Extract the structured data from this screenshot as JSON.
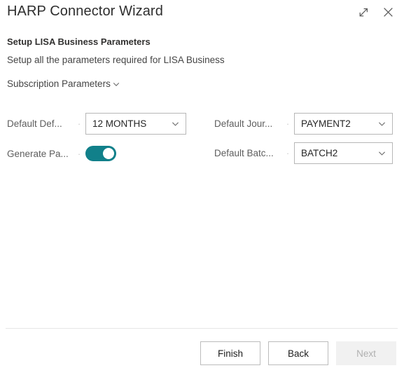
{
  "window": {
    "title": "HARP Connector Wizard",
    "expand_icon": "expand-diagonal-icon",
    "close_icon": "close-icon"
  },
  "step": {
    "heading": "Setup LISA Business Parameters",
    "subheading": "Setup all the parameters required for LISA Business"
  },
  "group": {
    "label": "Subscription Parameters",
    "chevron_icon": "chevron-down-icon",
    "expanded": true
  },
  "form": {
    "separator": "·",
    "left_fields": [
      {
        "label": "Default Def...",
        "type": "combobox",
        "value": "12 MONTHS",
        "chevron_icon": "chevron-down-icon"
      },
      {
        "label": "Generate Pa...",
        "type": "toggle",
        "state": "on"
      }
    ],
    "right_fields": [
      {
        "label": "Default Jour...",
        "type": "combobox",
        "value": "PAYMENT2",
        "chevron_icon": "chevron-down-icon"
      },
      {
        "label": "Default Batc...",
        "type": "combobox",
        "value": "BATCH2",
        "chevron_icon": "chevron-down-icon"
      }
    ]
  },
  "footer": {
    "finish_label": "Finish",
    "back_label": "Back",
    "next_label": "Next",
    "next_disabled": true
  },
  "colors": {
    "toggle_on": "#11808a",
    "text_primary": "#323130",
    "text_secondary": "#5e5e5e",
    "border": "#b7b7b7",
    "disabled_bg": "#f1f1f1"
  }
}
